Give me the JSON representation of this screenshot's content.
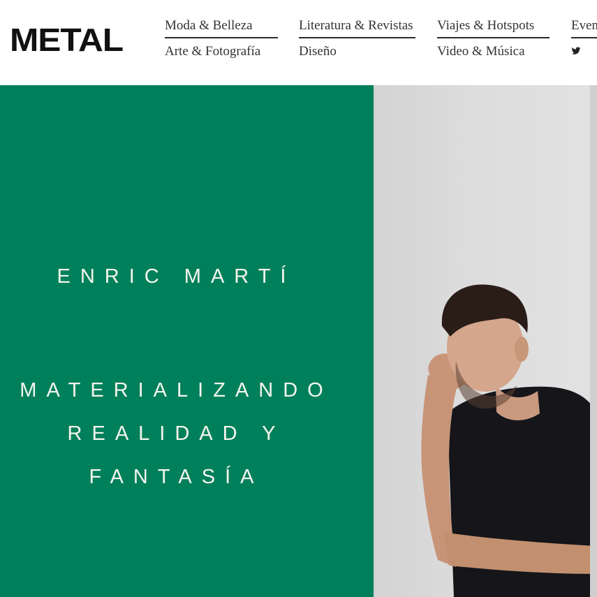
{
  "site": {
    "logo": "METAL"
  },
  "nav": {
    "columns": [
      {
        "top": "Moda & Belleza",
        "bottom": "Arte & Fotografía"
      },
      {
        "top": "Literatura & Revistas",
        "bottom": "Diseño"
      },
      {
        "top": "Viajes & Hotspots",
        "bottom": "Video & Música"
      },
      {
        "top": "Even"
      }
    ],
    "social_icons": [
      "twitter-icon",
      "facebook-icon"
    ]
  },
  "hero": {
    "author": "ENRIC MARTÍ",
    "headline_lines": [
      "MATERIALIZANDO",
      "REALIDAD Y",
      "FANTASÍA"
    ],
    "panel_color": "#00805a",
    "text_color": "#f5f5ee"
  }
}
